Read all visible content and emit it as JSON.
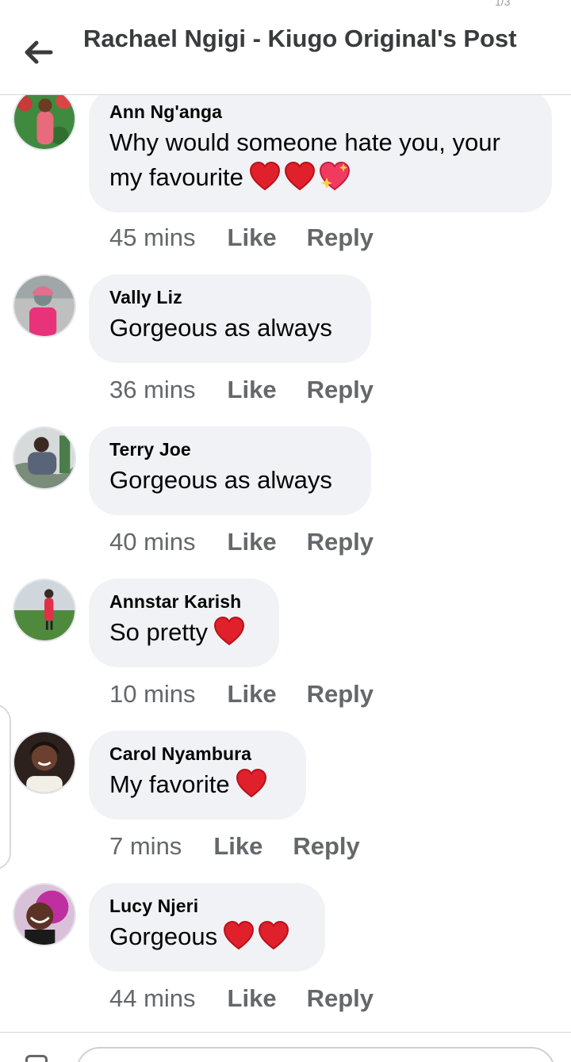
{
  "header": {
    "title": "Rachael Ngigi - Kiugo Original's Post",
    "status_text": "1/3"
  },
  "comments": [
    {
      "author": "Ann Ng'anga",
      "text": "Why would someone hate you, your my favourite",
      "time": "45 mins",
      "like": "Like",
      "reply": "Reply"
    },
    {
      "author": "Vally Liz",
      "text": "Gorgeous as always",
      "time": "36 mins",
      "like": "Like",
      "reply": "Reply"
    },
    {
      "author": "Terry Joe",
      "text": "Gorgeous as always",
      "time": "40 mins",
      "like": "Like",
      "reply": "Reply"
    },
    {
      "author": "Annstar Karish",
      "text": "So pretty",
      "time": "10 mins",
      "like": "Like",
      "reply": "Reply"
    },
    {
      "author": "Carol Nyambura",
      "text": "My favorite",
      "time": "7 mins",
      "like": "Like",
      "reply": "Reply"
    },
    {
      "author": "Lucy Njeri",
      "text": "Gorgeous",
      "time": "44 mins",
      "like": "Like",
      "reply": "Reply"
    }
  ],
  "composer": {
    "placeholder": ""
  },
  "colors": {
    "bubble": "#f0f2f5",
    "meta": "#65676b",
    "heart": "#e0202a"
  },
  "icons": [
    "back-arrow-icon",
    "red-heart-icon",
    "sparkling-heart-icon"
  ]
}
